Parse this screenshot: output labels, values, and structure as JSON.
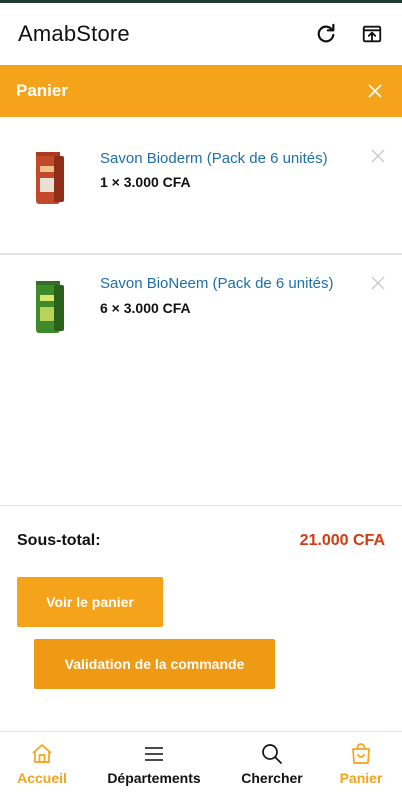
{
  "app": {
    "title": "AmabStore"
  },
  "appbar": {
    "refresh_icon": "refresh-icon",
    "open_icon": "open-external-icon"
  },
  "cart": {
    "title": "Panier",
    "items": [
      {
        "name": "Savon Bioderm (Pack de 6 unités)",
        "qty_price": "1 × 3.000 CFA",
        "image_color": "#c24a2a"
      },
      {
        "name": "Savon BioNeem (Pack de 6 unités)",
        "qty_price": "6 × 3.000 CFA",
        "image_color": "#3f8a2a"
      }
    ],
    "subtotal_label": "Sous-total:",
    "subtotal_value": "21.000 CFA",
    "view_cart_label": "Voir le panier",
    "checkout_label": "Validation de la commande"
  },
  "bottom_nav": {
    "items": [
      {
        "label": "Accueil",
        "icon": "home-icon",
        "active": true
      },
      {
        "label": "Départements",
        "icon": "menu-icon",
        "active": false
      },
      {
        "label": "Chercher",
        "icon": "search-icon",
        "active": false
      },
      {
        "label": "Panier",
        "icon": "shopping-bag-icon",
        "active": true
      }
    ]
  },
  "colors": {
    "accent": "#f5a31b",
    "price": "#d33a12",
    "link": "#1e6fa8"
  }
}
